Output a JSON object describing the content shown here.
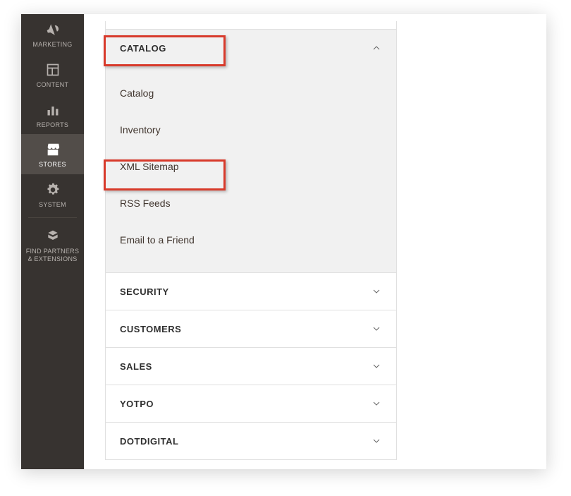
{
  "sidebar": {
    "items": [
      {
        "label": "MARKETING"
      },
      {
        "label": "CONTENT"
      },
      {
        "label": "REPORTS"
      },
      {
        "label": "STORES"
      },
      {
        "label": "SYSTEM"
      },
      {
        "label": "FIND PARTNERS & EXTENSIONS"
      }
    ]
  },
  "accordion": {
    "catalog": {
      "label": "CATALOG",
      "items": [
        {
          "label": "Catalog"
        },
        {
          "label": "Inventory"
        },
        {
          "label": "XML Sitemap"
        },
        {
          "label": "RSS Feeds"
        },
        {
          "label": "Email to a Friend"
        }
      ]
    },
    "sections": [
      {
        "label": "SECURITY"
      },
      {
        "label": "CUSTOMERS"
      },
      {
        "label": "SALES"
      },
      {
        "label": "YOTPO"
      },
      {
        "label": "DOTDIGITAL"
      }
    ]
  }
}
